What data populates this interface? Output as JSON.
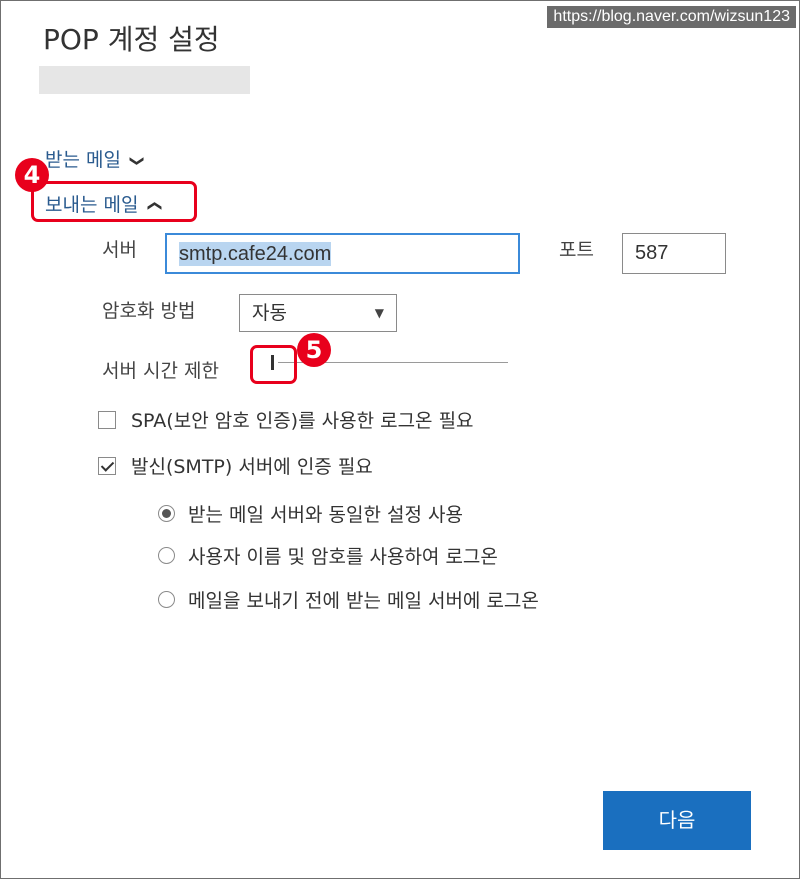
{
  "watermark": "https://blog.naver.com/wizsun123",
  "dialog": {
    "title": "POP 계정 설정"
  },
  "sections": {
    "incoming": {
      "label": "받는 메일",
      "expanded": false
    },
    "outgoing": {
      "label": "보내는 메일",
      "expanded": true
    }
  },
  "annotations": {
    "badge_4": "4",
    "badge_5": "5"
  },
  "outgoing_settings": {
    "server_label": "서버",
    "server_value": "smtp.cafe24.com",
    "port_label": "포트",
    "port_value": "587",
    "encryption_label": "암호화 방법",
    "encryption_value": "자동",
    "timeout_label": "서버 시간 제한",
    "timeout_level": 0,
    "spa": {
      "label": "SPA(보안 암호 인증)를 사용한 로그온 필요",
      "checked": false
    },
    "smtp_auth": {
      "label": "발신(SMTP) 서버에 인증 필요",
      "checked": true
    },
    "auth_options": [
      {
        "label": "받는 메일 서버와 동일한 설정 사용",
        "selected": true
      },
      {
        "label": "사용자 이름 및 암호를 사용하여 로그온",
        "selected": false
      },
      {
        "label": "메일을 보내기 전에 받는 메일 서버에 로그온",
        "selected": false
      }
    ]
  },
  "buttons": {
    "next": "다음"
  },
  "colors": {
    "accent": "#1a6fbf",
    "link": "#2a5b8f",
    "annotation": "#e8001c",
    "selection": "#b9d5f0"
  }
}
